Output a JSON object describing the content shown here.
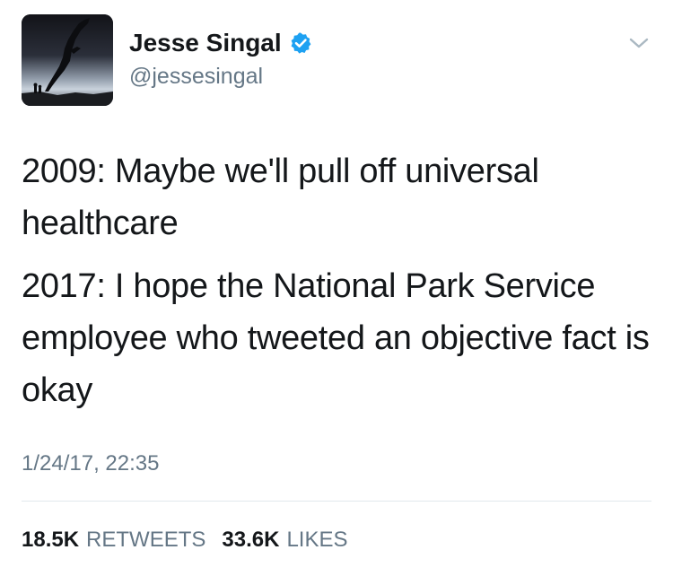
{
  "tweet": {
    "author": {
      "display_name": "Jesse Singal",
      "handle": "@jessesingal",
      "verified_icon": "verified-badge-icon",
      "avatar_icon": "avatar-silhouette-photo"
    },
    "menu_icon": "chevron-down-icon",
    "text": {
      "line1": "2009: Maybe we'll pull off universal healthcare",
      "line2": "2017: I hope the National Park Service employee who tweeted an objective fact is okay"
    },
    "timestamp": "1/24/17, 22:35",
    "stats": {
      "retweets_count": "18.5K",
      "retweets_label": "RETWEETS",
      "likes_count": "33.6K",
      "likes_label": "LIKES"
    },
    "colors": {
      "text": "#14171a",
      "secondary": "#657786",
      "verified": "#1da1f2",
      "divider": "#e1e8ed"
    }
  }
}
